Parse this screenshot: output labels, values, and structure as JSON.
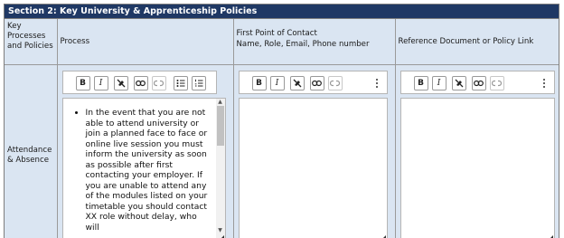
{
  "section": {
    "title": "Section 2: Key University & Apprenticeship Policies"
  },
  "headers": {
    "key": "Key Processes and Policies",
    "process": "Process",
    "contact_line1": "First Point of Contact",
    "contact_line2": "Name, Role, Email, Phone number",
    "reference": "Reference Document or Policy Link"
  },
  "rows": [
    {
      "label": "Attendance & Absence",
      "process_text": "In the event that you are not able to attend university or join a planned face to face or online live session you must inform the university as soon as possible after first contacting your employer. If you are unable to attend any of the modules listed on your timetable you should contact XX role without delay, who will",
      "contact_text": "",
      "reference_text": ""
    }
  ],
  "toolbar": {
    "bold": "B",
    "italic": "I",
    "more_label": "More options"
  },
  "icons": [
    "clear-format-icon",
    "link-icon",
    "unlink-icon",
    "bullet-list-icon",
    "numbered-list-icon",
    "more-vertical-icon",
    "resize-handle-icon"
  ],
  "colors": {
    "section_bar": "#1f3864",
    "header_bg": "#dae5f2"
  }
}
